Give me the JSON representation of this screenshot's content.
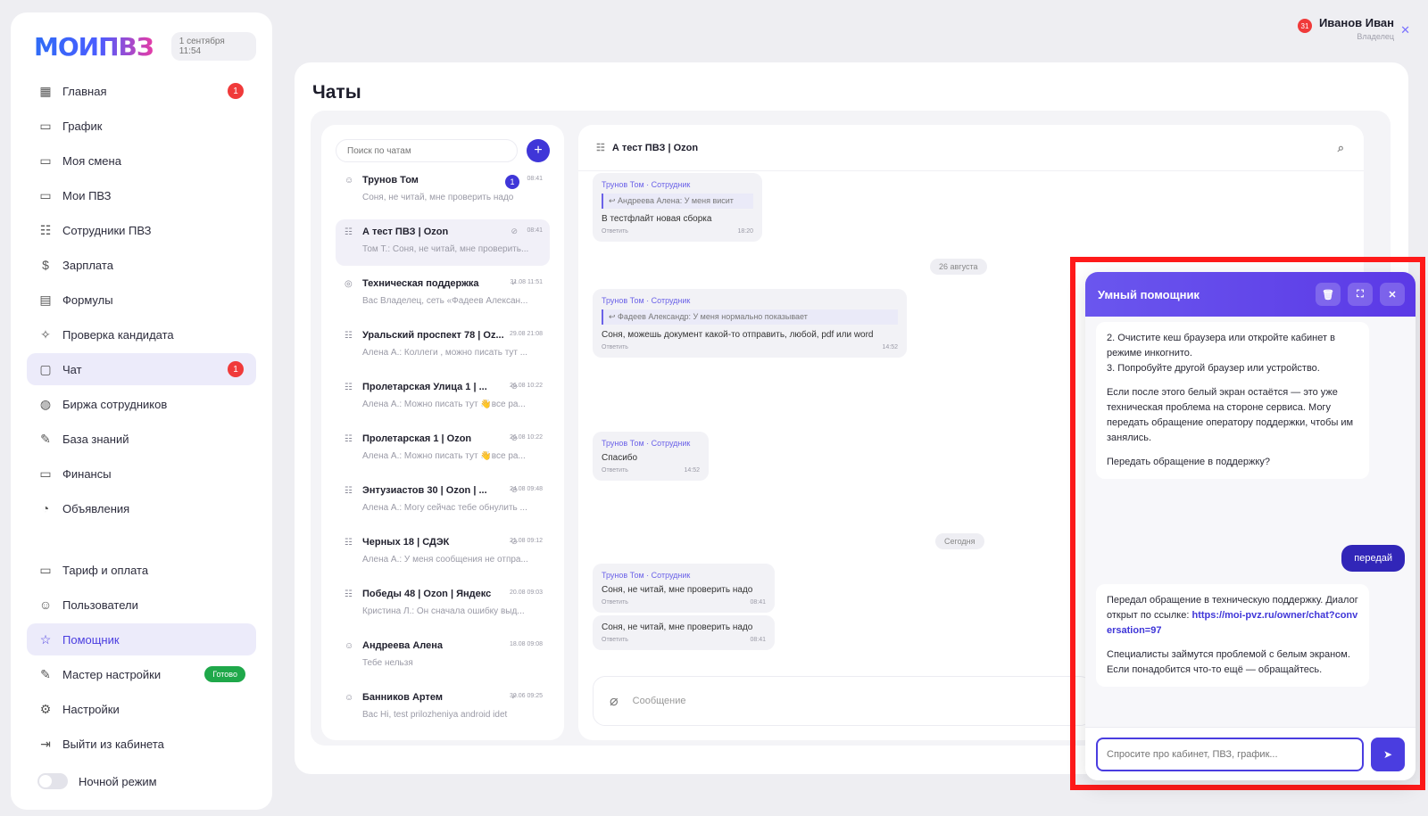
{
  "app": {
    "logo": "МОИПВЗ",
    "datetime": "1 сентября 11:54"
  },
  "sidebar": {
    "items": [
      {
        "label": "Главная",
        "icon": "grid-icon",
        "glyph": "▦",
        "badge": "1"
      },
      {
        "label": "График",
        "icon": "calendar-icon",
        "glyph": "▭"
      },
      {
        "label": "Моя смена",
        "icon": "shift-icon",
        "glyph": "▭"
      },
      {
        "label": "Мои ПВЗ",
        "icon": "store-icon",
        "glyph": "▭"
      },
      {
        "label": "Сотрудники ПВЗ",
        "icon": "team-icon",
        "glyph": "☷"
      },
      {
        "label": "Зарплата",
        "icon": "dollar-icon",
        "glyph": "$"
      },
      {
        "label": "Формулы",
        "icon": "formula-icon",
        "glyph": "▤"
      },
      {
        "label": "Проверка кандидата",
        "icon": "sparkle-icon",
        "glyph": "✧"
      },
      {
        "label": "Чат",
        "icon": "chat-icon",
        "glyph": "▢",
        "badge": "1",
        "active": true
      },
      {
        "label": "Биржа сотрудников",
        "icon": "globe-icon",
        "glyph": "◍"
      },
      {
        "label": "База знаний",
        "icon": "pen-icon",
        "glyph": "✎"
      },
      {
        "label": "Финансы",
        "icon": "wallet-icon",
        "glyph": "▭"
      },
      {
        "label": "Объявления",
        "icon": "announce-icon",
        "glyph": "◔"
      }
    ],
    "items2": [
      {
        "label": "Тариф и оплата",
        "icon": "card-icon",
        "glyph": "▭"
      },
      {
        "label": "Пользователи",
        "icon": "users-icon",
        "glyph": "☺"
      },
      {
        "label": "Помощник",
        "icon": "star-icon",
        "glyph": "☆",
        "active_blue": true
      },
      {
        "label": "Мастер настройки",
        "icon": "wand-icon",
        "glyph": "✎",
        "ready": "Готово"
      },
      {
        "label": "Настройки",
        "icon": "gear-icon",
        "glyph": "⚙"
      },
      {
        "label": "Выйти из кабинета",
        "icon": "logout-icon",
        "glyph": "⇥"
      }
    ],
    "night_mode": "Ночной режим"
  },
  "user": {
    "name": "Иванов Иван",
    "role": "Владелец",
    "badge": "31"
  },
  "page": {
    "title": "Чаты"
  },
  "chatlist": {
    "search_placeholder": "Поиск по чатам",
    "add": "+",
    "conversations": [
      {
        "title": "Трунов Том",
        "preview": "Соня, не читай, мне проверить надо",
        "time": "08:41",
        "badge": "1",
        "icon": "person"
      },
      {
        "title": "А тест ПВЗ | Ozon",
        "preview": "Том Т.: Соня, не читай, мне проверить...",
        "time": "08:41",
        "muted": true,
        "selected": true,
        "icon": "group"
      },
      {
        "title": "Техническая поддержка",
        "preview": "Вас Владелец, сеть «Фадеев Алексан...",
        "time": "31.08 11:51",
        "check": true,
        "icon": "support"
      },
      {
        "title": "Уральский проспект 78 | Oz...",
        "preview": "Алена А.: Коллеги , можно писать тут ...",
        "time": "29.08 21:08",
        "icon": "group"
      },
      {
        "title": "Пролетарская Улица 1 | ...",
        "preview": "Алена А.: Можно писать тут 👋все ра...",
        "time": "26.08 10:22",
        "muted": true,
        "icon": "group"
      },
      {
        "title": "Пролетарская 1 | Ozon",
        "preview": "Алена А.: Можно писать тут 👋все ра...",
        "time": "26.08 10:22",
        "muted": true,
        "icon": "group"
      },
      {
        "title": "Энтузиастов 30 | Ozon | ...",
        "preview": "Алена А.: Могу сейчас тебе обнулить ...",
        "time": "24.08 09:48",
        "muted": true,
        "icon": "group"
      },
      {
        "title": "Черных 18 | СДЭК",
        "preview": "Алена А.: У меня сообщения не отпра...",
        "time": "21.08 09:12",
        "muted": true,
        "icon": "group"
      },
      {
        "title": "Победы 48 | Ozon | Яндекс",
        "preview": "Кристина Л.: Он сначала ошибку выд...",
        "time": "20.08 09:03",
        "icon": "group"
      },
      {
        "title": "Андреева Алена",
        "preview": "Тебе нельзя",
        "time": "18.08 09:08",
        "icon": "person"
      },
      {
        "title": "Банников Артем",
        "preview": "Вас Hi, test prilozheniya android idet",
        "time": "30.06 09:25",
        "check": true,
        "icon": "person"
      }
    ]
  },
  "chat": {
    "header": "А тест ПВЗ | Ozon",
    "messages": [
      {
        "author": "Трунов Том · Сотрудник",
        "quote": "↩ Андреева Алена: У меня висит",
        "text": "В тестфлайт новая сборка",
        "reply": "Ответить",
        "time": "18:20"
      },
      {
        "author": "Трунов Том · Сотрудник",
        "quote": "↩ Фадеев Александр: У меня нормально показывает",
        "text": "Соня, можешь документ какой-то отправить, любой, pdf или word",
        "reply": "Ответить",
        "time": "14:52"
      },
      {
        "author": "Трунов Том · Сотрудник",
        "text": "Спасибо",
        "reply": "Ответить",
        "time": "14:52"
      },
      {
        "author": "Трунов Том · Сотрудник",
        "text": "Соня, не читай, мне проверить надо",
        "reply": "Ответить",
        "time": "08:41"
      },
      {
        "text": "Соня, не читай, мне проверить надо",
        "reply": "Ответить",
        "time": "08:41"
      }
    ],
    "date1": "26 августа",
    "date2": "Сегодня",
    "compose_placeholder": "Сообщение"
  },
  "assistant": {
    "title": "Умный помощник",
    "bubble1": [
      "2. Очистите кеш браузера или откройте кабинет в режиме инкогнито.\n3. Попробуйте другой браузер или устройство.",
      "Если после этого белый экран остаётся — это уже техническая проблема на стороне сервиса. Могу передать обращение оператору поддержки, чтобы им занялись.",
      "Передать обращение в поддержку?"
    ],
    "user_reply": "передай",
    "bubble2_text": "Передал обращение в техническую поддержку. Диалог открыт по ссылке:",
    "bubble2_link": "https://moi-pvz.ru/owner/chat?conversation=97",
    "bubble2_more": "Специалисты займутся проблемой с белым экраном. Если понадобится что-то ещё — обращайтесь.",
    "input_placeholder": "Спросите про кабинет, ПВЗ, график..."
  }
}
